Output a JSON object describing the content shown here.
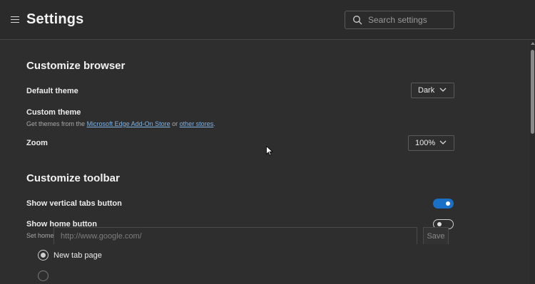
{
  "header": {
    "title": "Settings",
    "search_placeholder": "Search settings",
    "icons": {
      "menu": "hamburger-icon",
      "search": "search-icon"
    }
  },
  "customize_browser": {
    "title": "Customize browser",
    "default_theme": {
      "label": "Default theme",
      "value": "Dark"
    },
    "custom_theme": {
      "label": "Custom theme",
      "desc_prefix": "Get themes from the",
      "link_store": "Microsoft Edge Add-On Store",
      "desc_mid": "or",
      "link_other": "other stores",
      "desc_suffix": "."
    },
    "zoom": {
      "label": "Zoom",
      "value": "100%"
    }
  },
  "customize_toolbar": {
    "title": "Customize toolbar",
    "vertical_tabs": {
      "label": "Show vertical tabs button",
      "enabled": true
    },
    "home_button": {
      "label": "Show home button",
      "enabled": false,
      "desc": "Set home page below",
      "option_new_tab": "New tab page",
      "url_placeholder": "http://www.google.com/",
      "save_label": "Save"
    }
  },
  "colors": {
    "background": "#2e2e2e",
    "accent": "#1a6fc7",
    "link": "#7fb3e6"
  }
}
